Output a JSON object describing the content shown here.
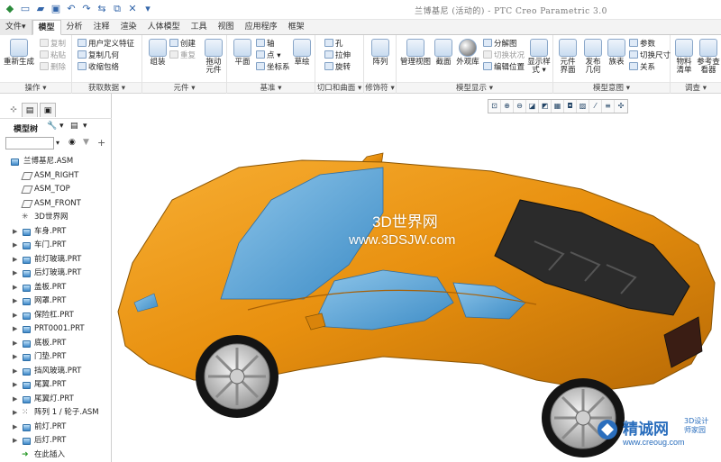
{
  "app": {
    "window_title": "兰博基尼 (活动的) - PTC Creo Parametric 3.0"
  },
  "tabs": [
    "文件▾",
    "模型",
    "分析",
    "注释",
    "渲染",
    "人体模型",
    "工具",
    "视图",
    "应用程序",
    "框架"
  ],
  "ribbon": {
    "groups": {
      "operations": "操作 ▾",
      "get_data": "获取数据 ▾",
      "component": "元件 ▾",
      "datum": "基准 ▾",
      "cut_surface": "切口和曲面 ▾",
      "modifiers": "修饰符 ▾",
      "model_display": "模型显示 ▾",
      "model_intent": "模型意图 ▾",
      "investigate": "调查 ▾"
    },
    "regenerate": "重新生成",
    "copy": "复制",
    "paste": "粘贴",
    "delete": "删除",
    "udf": "用户定义特征",
    "copy_geom": "复制几何",
    "shrinkwrap": "收缩包络",
    "assemble": "组装",
    "create": "创建",
    "repeat": "重复",
    "drag_components_l1": "拖动",
    "drag_components_l2": "元件",
    "plane": "平面",
    "axis": "轴",
    "point": "点 ▾",
    "csys": "坐标系",
    "sketch": "草绘",
    "hole": "孔",
    "extrude": "拉伸",
    "revolve": "旋转",
    "pattern": "阵列",
    "manage_views": "管理视图",
    "section": "截面",
    "appearance": "外观库",
    "exploded_view": "分解图",
    "toggle_status": "切换状况",
    "edit_position": "编辑位置",
    "display_style_l1": "显示样",
    "display_style_l2": "式 ▾",
    "component_interface_l1": "元件",
    "component_interface_l2": "界面",
    "publish_geom_l1": "发布",
    "publish_geom_l2": "几何",
    "family_table": "族表",
    "parameters": "参数",
    "switch_dimensions": "切换尺寸",
    "relations": "关系",
    "bom_l1": "物料",
    "bom_l2": "清单",
    "ref_viewer_l1": "参考查",
    "ref_viewer_l2": "看器"
  },
  "model_tree": {
    "title": "模型树",
    "items": [
      {
        "label": "兰博基尼.ASM",
        "kind": "asm",
        "expand": false
      },
      {
        "label": "ASM_RIGHT",
        "kind": "plane",
        "expand": false
      },
      {
        "label": "ASM_TOP",
        "kind": "plane",
        "expand": false
      },
      {
        "label": "ASM_FRONT",
        "kind": "plane",
        "expand": false
      },
      {
        "label": "3D世界网",
        "kind": "csys",
        "expand": false
      },
      {
        "label": "车身.PRT",
        "kind": "prt",
        "expand": true
      },
      {
        "label": "车门.PRT",
        "kind": "prt",
        "expand": true
      },
      {
        "label": "前灯玻璃.PRT",
        "kind": "prt",
        "expand": true
      },
      {
        "label": "后灯玻璃.PRT",
        "kind": "prt",
        "expand": true
      },
      {
        "label": "盖板.PRT",
        "kind": "prt",
        "expand": true
      },
      {
        "label": "网罩.PRT",
        "kind": "prt",
        "expand": true
      },
      {
        "label": "保险杠.PRT",
        "kind": "prt",
        "expand": true
      },
      {
        "label": "PRT0001.PRT",
        "kind": "prt",
        "expand": true
      },
      {
        "label": "底板.PRT",
        "kind": "prt",
        "expand": true
      },
      {
        "label": "门垫.PRT",
        "kind": "prt",
        "expand": true
      },
      {
        "label": "挡风玻璃.PRT",
        "kind": "prt",
        "expand": true
      },
      {
        "label": "尾翼.PRT",
        "kind": "prt",
        "expand": true
      },
      {
        "label": "尾翼灯.PRT",
        "kind": "prt",
        "expand": true
      },
      {
        "label": "阵列 1 / 轮子.ASM",
        "kind": "pattern",
        "expand": true
      },
      {
        "label": "前灯.PRT",
        "kind": "prt",
        "expand": true
      },
      {
        "label": "后灯.PRT",
        "kind": "prt",
        "expand": true
      },
      {
        "label": "在此插入",
        "kind": "insert",
        "expand": false
      }
    ]
  },
  "viewport": {
    "watermark_line1": "3D世界网",
    "watermark_line2": "www.3DSJW.com",
    "logo_name": "精诚网",
    "logo_sub1": "3D设计",
    "logo_sub2": "师家园",
    "logo_url": "www.creoug.com"
  },
  "colors": {
    "car_body": "#e8900f",
    "glass": "#5fa8da",
    "accent": "#2a6ebd"
  }
}
